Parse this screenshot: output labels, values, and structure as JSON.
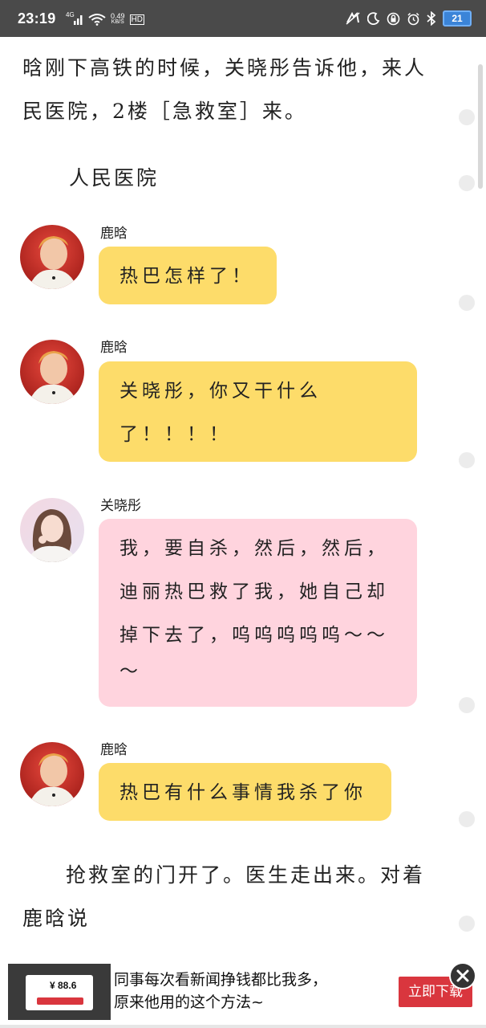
{
  "status_bar": {
    "time": "23:19",
    "network_type": "4G",
    "speed_value": "0.49",
    "speed_unit": "KB/S",
    "hd_label": "HD",
    "battery_level": "21",
    "accent_battery": "#3b84d8"
  },
  "story": {
    "para1_line1": "晗刚下高铁的时候，关晓彤告诉他，来人",
    "para1_line2": "民医院，2楼［急救室］来。",
    "scene_heading": "人民医院",
    "para_end_line1": "抢救室的门开了。医生走出来。对着",
    "para_end_line2": "鹿晗说"
  },
  "messages": [
    {
      "speaker": "鹿晗",
      "lines": [
        "热巴怎样了！"
      ],
      "color": "#fddc6a",
      "avatar_icon": "avatar-luhan-icon"
    },
    {
      "speaker": "鹿晗",
      "lines": [
        "关晓彤，你又干什么",
        "了！！！！"
      ],
      "color": "#fddc6a",
      "avatar_icon": "avatar-luhan-icon"
    },
    {
      "speaker": "关晓彤",
      "lines": [
        "我，要自杀，然后，然后，",
        "迪丽热巴救了我，她自己却",
        "掉下去了，呜呜呜呜呜～～",
        "～"
      ],
      "color": "#ffd4de",
      "avatar_icon": "avatar-guanxiaotong-icon"
    },
    {
      "speaker": "鹿晗",
      "lines": [
        "热巴有什么事情我杀了你"
      ],
      "color": "#fddc6a",
      "avatar_icon": "avatar-luhan-icon"
    }
  ],
  "ad": {
    "headline_line1": "同事每次看新闻挣钱都比我多，",
    "headline_line2": "原来他用的这个方法~",
    "cta_label": "立即下载",
    "thumb_price": "¥ 88.6",
    "cta_color": "#d9363e"
  }
}
